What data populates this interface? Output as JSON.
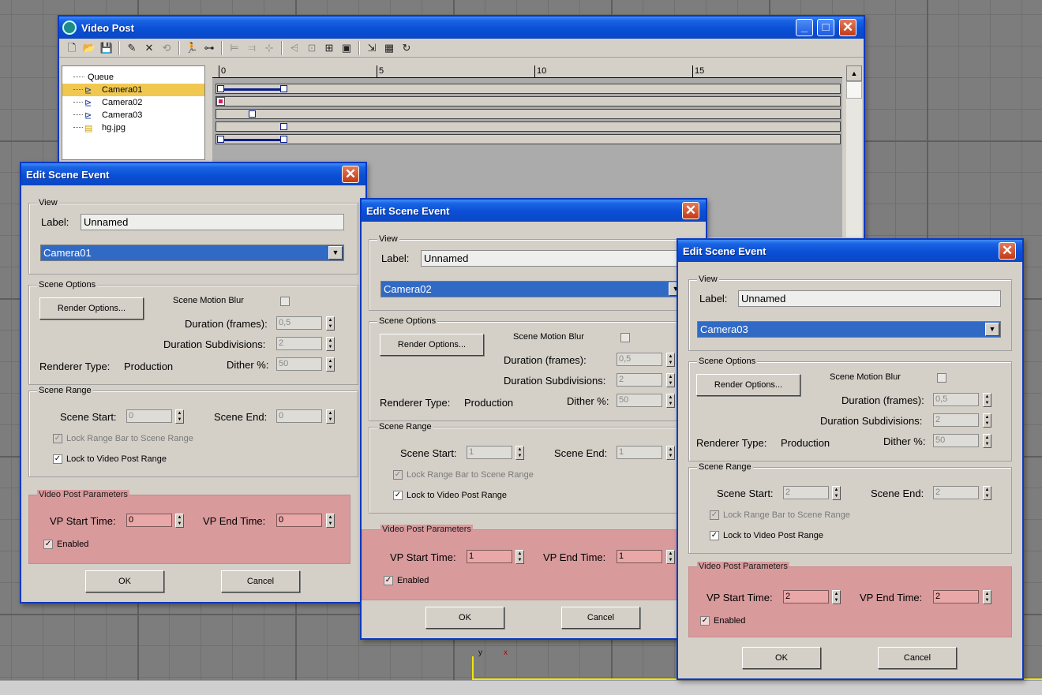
{
  "videopost": {
    "title": "Video Post",
    "tree": [
      {
        "label": "Queue"
      },
      {
        "label": "Camera01"
      },
      {
        "label": "Camera02"
      },
      {
        "label": "Camera03"
      },
      {
        "label": "hg.jpg"
      }
    ],
    "ruler_labels": [
      "0",
      "5",
      "10",
      "15"
    ]
  },
  "dialogs": [
    {
      "title": "Edit Scene Event",
      "view_group": "View",
      "label_caption": "Label:",
      "label_value": "Unnamed",
      "camera": "Camera01",
      "scene_options_group": "Scene Options",
      "render_options_button": "Render Options...",
      "scene_motion_blur": "Scene Motion Blur",
      "duration_frames_label": "Duration (frames):",
      "duration_frames": "0,5",
      "duration_subdiv_label": "Duration Subdivisions:",
      "duration_subdiv": "2",
      "renderer_type_label": "Renderer Type:",
      "renderer_type": "Production",
      "dither_label": "Dither %:",
      "dither": "50",
      "scene_range_group": "Scene Range",
      "scene_start_label": "Scene Start:",
      "scene_start": "0",
      "scene_end_label": "Scene End:",
      "scene_end": "0",
      "lock_range_bar": "Lock Range Bar to Scene Range",
      "lock_video_post": "Lock to Video Post Range",
      "vp_params_group": "Video Post Parameters",
      "vp_start_label": "VP Start Time:",
      "vp_start": "0",
      "vp_end_label": "VP End Time:",
      "vp_end": "0",
      "enabled": "Enabled",
      "ok": "OK",
      "cancel": "Cancel"
    },
    {
      "title": "Edit Scene Event",
      "view_group": "View",
      "label_caption": "Label:",
      "label_value": "Unnamed",
      "camera": "Camera02",
      "scene_options_group": "Scene Options",
      "render_options_button": "Render Options...",
      "scene_motion_blur": "Scene Motion Blur",
      "duration_frames_label": "Duration (frames):",
      "duration_frames": "0,5",
      "duration_subdiv_label": "Duration Subdivisions:",
      "duration_subdiv": "2",
      "renderer_type_label": "Renderer Type:",
      "renderer_type": "Production",
      "dither_label": "Dither %:",
      "dither": "50",
      "scene_range_group": "Scene Range",
      "scene_start_label": "Scene Start:",
      "scene_start": "1",
      "scene_end_label": "Scene End:",
      "scene_end": "1",
      "lock_range_bar": "Lock Range Bar to Scene Range",
      "lock_video_post": "Lock to Video Post Range",
      "vp_params_group": "Video Post Parameters",
      "vp_start_label": "VP Start Time:",
      "vp_start": "1",
      "vp_end_label": "VP End Time:",
      "vp_end": "1",
      "enabled": "Enabled",
      "ok": "OK",
      "cancel": "Cancel"
    },
    {
      "title": "Edit Scene Event",
      "view_group": "View",
      "label_caption": "Label:",
      "label_value": "Unnamed",
      "camera": "Camera03",
      "scene_options_group": "Scene Options",
      "render_options_button": "Render Options...",
      "scene_motion_blur": "Scene Motion Blur",
      "duration_frames_label": "Duration (frames):",
      "duration_frames": "0,5",
      "duration_subdiv_label": "Duration Subdivisions:",
      "duration_subdiv": "2",
      "renderer_type_label": "Renderer Type:",
      "renderer_type": "Production",
      "dither_label": "Dither %:",
      "dither": "50",
      "scene_range_group": "Scene Range",
      "scene_start_label": "Scene Start:",
      "scene_start": "2",
      "scene_end_label": "Scene End:",
      "scene_end": "2",
      "lock_range_bar": "Lock Range Bar to Scene Range",
      "lock_video_post": "Lock to Video Post Range",
      "vp_params_group": "Video Post Parameters",
      "vp_start_label": "VP Start Time:",
      "vp_start": "2",
      "vp_end_label": "VP End Time:",
      "vp_end": "2",
      "enabled": "Enabled",
      "ok": "OK",
      "cancel": "Cancel"
    }
  ],
  "viewport": {
    "axis_y": "y",
    "axis_x": "x"
  }
}
